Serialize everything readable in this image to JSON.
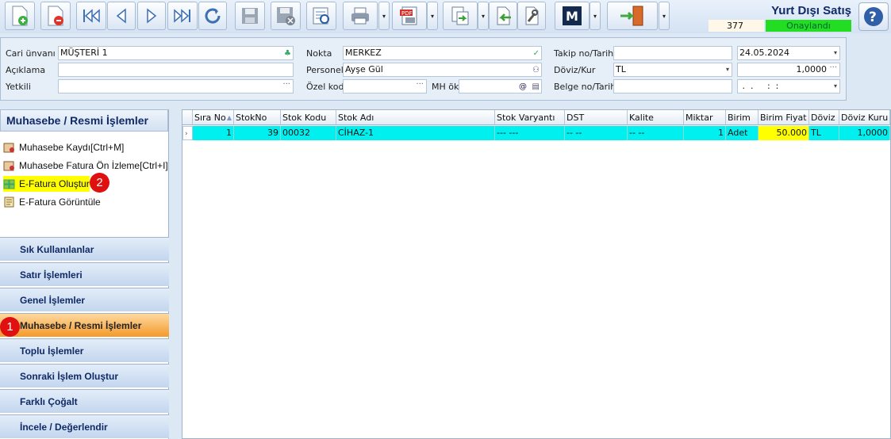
{
  "toolbar": {
    "buttons": [
      "new-document-icon",
      "delete-document-icon",
      "first-record-icon",
      "previous-record-icon",
      "next-record-icon",
      "last-record-icon",
      "refresh-icon",
      "save-icon",
      "save-close-icon",
      "report-icon",
      "print-icon",
      "pdf-export-icon",
      "export-icon",
      "import-icon",
      "tools-icon",
      "m-app-icon",
      "exit-door-icon"
    ],
    "title": "Yurt Dışı Satış",
    "doc_number": "377",
    "status": "Onaylandı",
    "accent": "#22dd22"
  },
  "form": {
    "cari_label": "Cari ünvanı",
    "cari_value": "MÜŞTERİ 1",
    "aciklama_label": "Açıklama",
    "aciklama_value": "",
    "yetkili_label": "Yetkili",
    "yetkili_value": "",
    "nokta_label": "Nokta",
    "nokta_value": "MERKEZ",
    "personel_label": "Personel",
    "personel_value": "Ayşe Gül",
    "ozelkod_label": "Özel kod",
    "ozelkod_value": "",
    "mhok_label": "MH ök",
    "mhok_value": "",
    "takip_label": "Takip no/Tarih",
    "takip_value": "",
    "takip_date": "24.05.2024",
    "doviz_label": "Döviz/Kur",
    "doviz_value": "TL",
    "kur_value": "1,0000",
    "belge_label": "Belge no/Tarih",
    "belge_value": "",
    "belge_date": " .  .     :  :"
  },
  "left_panel": {
    "header": "Muhasebe / Resmi İşlemler",
    "actions": [
      {
        "label": "Muhasebe Kaydı[Ctrl+M]"
      },
      {
        "label": "Muhasebe Fatura Ön İzleme[Ctrl+I]"
      },
      {
        "label": "E-Fatura Oluştur"
      },
      {
        "label": "E-Fatura Görüntüle"
      }
    ],
    "groups": [
      "Sık Kullanılanlar",
      "Satır İşlemleri",
      "Genel İşlemler",
      "Muhasebe / Resmi İşlemler",
      "Toplu İşlemler",
      "Sonraki İşlem Oluştur",
      "Farklı Çoğalt",
      "İncele / Değerlendir"
    ],
    "badge1": "1",
    "badge2": "2"
  },
  "grid": {
    "columns": [
      "Sıra No",
      "StokNo",
      "Stok Kodu",
      "Stok Adı",
      "Stok Varyantı",
      "DST",
      "Kalite",
      "Miktar",
      "Birim",
      "Birim Fiyat",
      "Döviz",
      "Döviz Kuru"
    ],
    "rows": [
      [
        "1",
        "39",
        "00032",
        "CİHAZ-1",
        "--- ---",
        "-- --",
        "-- --",
        "1",
        "Adet",
        "50.000",
        "TL",
        "1,0000"
      ]
    ]
  }
}
